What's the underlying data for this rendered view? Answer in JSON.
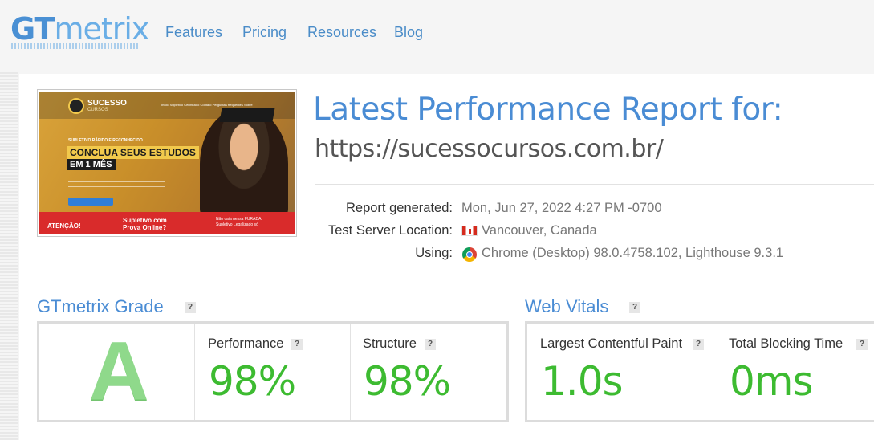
{
  "brand": {
    "logo_gt": "GT",
    "logo_metrix": "metrix"
  },
  "nav": {
    "items": [
      {
        "label": "Features"
      },
      {
        "label": "Pricing"
      },
      {
        "label": "Resources"
      },
      {
        "label": "Blog"
      }
    ]
  },
  "thumbnail": {
    "brand": "SUCESSO",
    "brand_sub": "CURSOS",
    "nav_links": "Início   Supletivo   Certificado   Contato   Perguntas frequentes   Sobre",
    "tagline": "SUPLETIVO RÁPIDO E RECONHECIDO",
    "headline_1": "CONCLUA SEUS ESTUDOS",
    "headline_2": "EM 1 MÊS",
    "footer_1": "ATENÇÃO!",
    "footer_2": "Supletivo com\nProva Online?",
    "footer_3": "Não caia nessa FURADA.\nSupletivo Legalizado só"
  },
  "report": {
    "title": "Latest Performance Report for:",
    "url": "https://sucessocursos.com.br/",
    "meta": {
      "generated_label": "Report generated:",
      "generated_value": "Mon, Jun 27, 2022 4:27 PM -0700",
      "location_label": "Test Server Location:",
      "location_value": "Vancouver, Canada",
      "using_label": "Using:",
      "using_value": "Chrome (Desktop) 98.0.4758.102, Lighthouse 9.3.1"
    }
  },
  "grade": {
    "title": "GTmetrix Grade",
    "letter": "A",
    "performance_label": "Performance",
    "performance_value": "98%",
    "structure_label": "Structure",
    "structure_value": "98%"
  },
  "vitals": {
    "title": "Web Vitals",
    "lcp_label": "Largest Contentful Paint",
    "lcp_value": "1.0s",
    "tbt_label": "Total Blocking Time",
    "tbt_value": "0ms"
  },
  "help_glyph": "?",
  "colors": {
    "link_blue": "#4a8cd4",
    "grade_green": "#3dbb31",
    "background": "#f5f5f5"
  },
  "icons": {
    "help": "question-mark-icon",
    "flag": "canada-flag-icon",
    "browser": "chrome-icon"
  }
}
